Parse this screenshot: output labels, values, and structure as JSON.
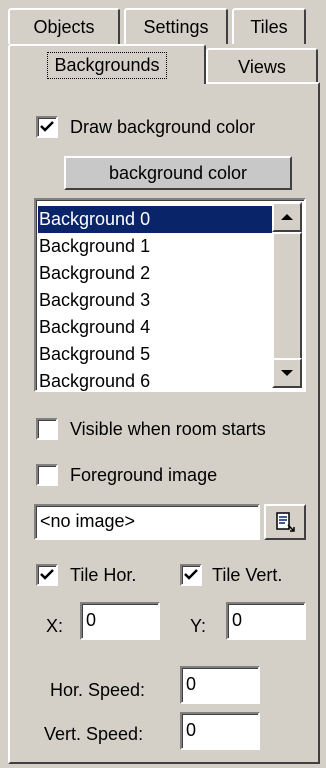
{
  "tabs": {
    "row1": [
      {
        "label": "Objects"
      },
      {
        "label": "Settings"
      },
      {
        "label": "Tiles"
      }
    ],
    "row2": [
      {
        "label": "Backgrounds",
        "active": true
      },
      {
        "label": "Views"
      }
    ]
  },
  "draw_bg": {
    "label": "Draw background color",
    "checked": true
  },
  "bg_color_button": "background color",
  "backgrounds_list": {
    "items": [
      "Background 0",
      "Background 1",
      "Background 2",
      "Background 3",
      "Background 4",
      "Background 5",
      "Background 6"
    ],
    "selected_index": 0
  },
  "visible_start": {
    "label": "Visible when room starts",
    "checked": false
  },
  "foreground": {
    "label": "Foreground image",
    "checked": false
  },
  "image_field": {
    "value": "<no image>"
  },
  "tile_hor": {
    "label": "Tile Hor.",
    "checked": true
  },
  "tile_vert": {
    "label": "Tile Vert.",
    "checked": true
  },
  "x_field": {
    "label": "X:",
    "value": "0"
  },
  "y_field": {
    "label": "Y:",
    "value": "0"
  },
  "hor_speed": {
    "label": "Hor. Speed:",
    "value": "0"
  },
  "vert_speed": {
    "label": "Vert. Speed:",
    "value": "0"
  }
}
